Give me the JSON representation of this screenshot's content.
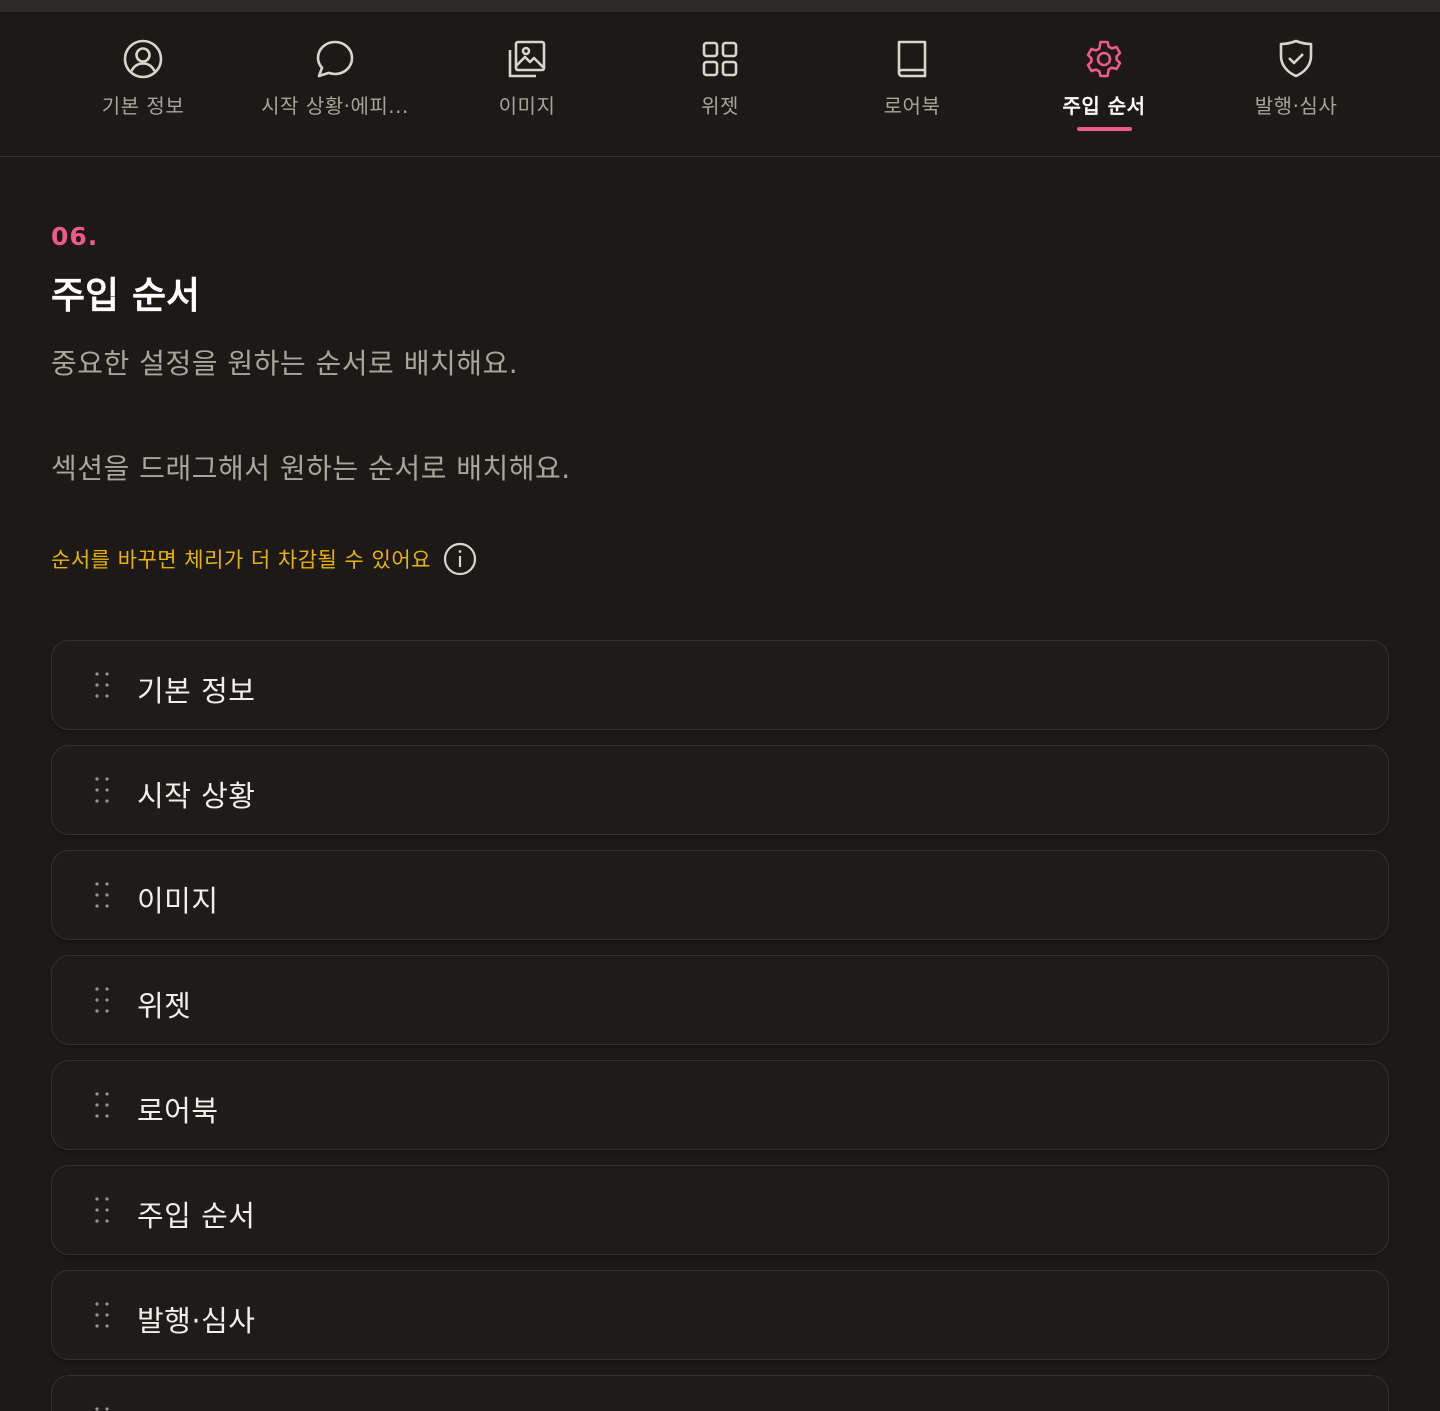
{
  "tabs": [
    {
      "id": "basic",
      "label": "기본 정보",
      "icon": "user-circle-icon",
      "active": false
    },
    {
      "id": "start",
      "label": "시작 상황·에피...",
      "icon": "chat-bubble-icon",
      "active": false
    },
    {
      "id": "image",
      "label": "이미지",
      "icon": "image-gallery-icon",
      "active": false
    },
    {
      "id": "widget",
      "label": "위젯",
      "icon": "grid-icon",
      "active": false
    },
    {
      "id": "lorebook",
      "label": "로어북",
      "icon": "book-icon",
      "active": false
    },
    {
      "id": "order",
      "label": "주입 순서",
      "icon": "gear-icon",
      "active": true
    },
    {
      "id": "publish",
      "label": "발행·심사",
      "icon": "shield-check-icon",
      "active": false
    }
  ],
  "section": {
    "step": "06.",
    "title": "주입 순서",
    "subtitle": "중요한 설정을 원하는 순서로 배치해요.",
    "instruction": "섹션을 드래그해서 원하는 순서로 배치해요.",
    "warning": "순서를 바꾸면 체리가 더 차감될 수 있어요"
  },
  "order_list": [
    "기본 정보",
    "시작 상황",
    "이미지",
    "위젯",
    "로어북",
    "주입 순서",
    "발행·심사",
    ""
  ],
  "colors": {
    "accent": "#f05a8a",
    "warning": "#e8b400",
    "background": "#1c1916"
  }
}
